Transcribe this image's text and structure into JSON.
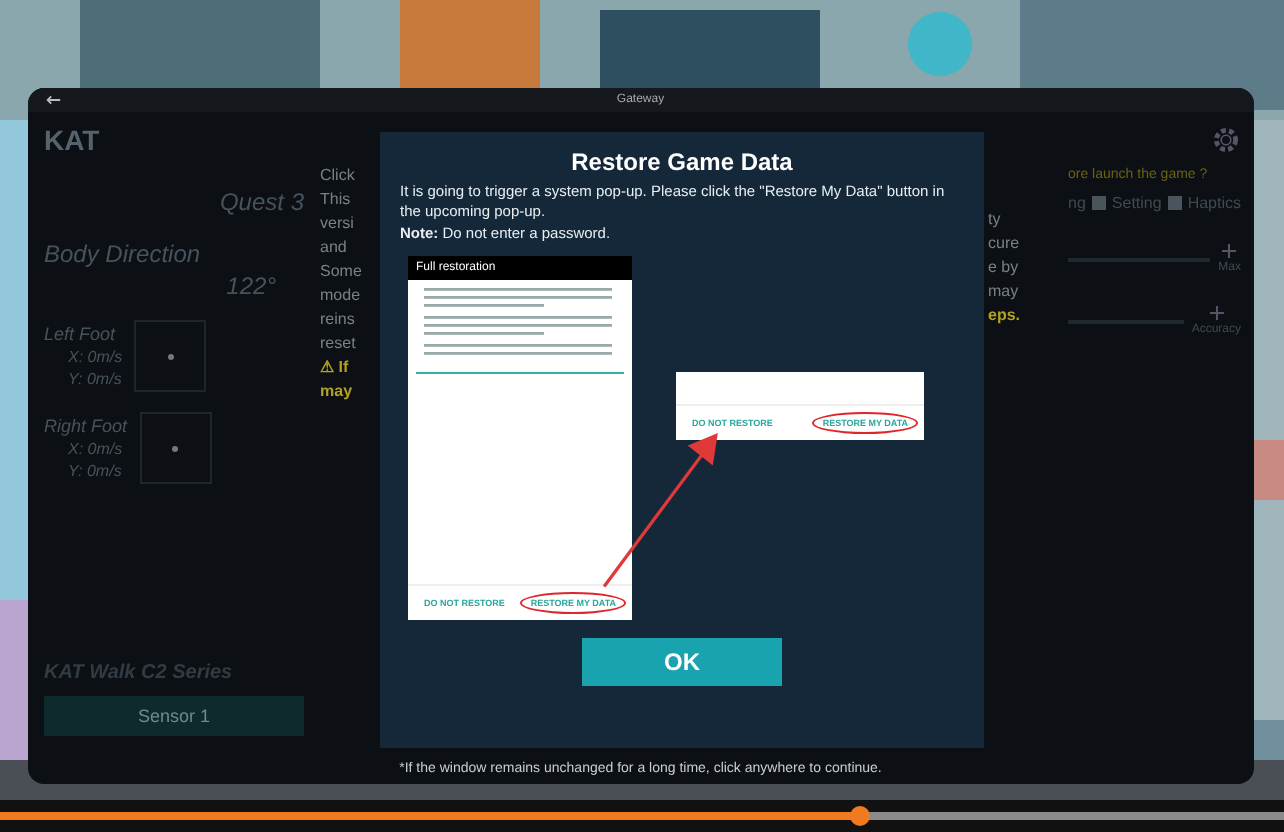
{
  "window": {
    "title": "Gateway"
  },
  "sidebar": {
    "logo": "KAT",
    "device": "Quest 3",
    "direction_label": "Body Direction",
    "direction_value": "122°",
    "feet": [
      {
        "label": "Left Foot",
        "x": "X: 0m/s",
        "y": "Y: 0m/s"
      },
      {
        "label": "Right Foot",
        "x": "X: 0m/s",
        "y": "Y: 0m/s"
      }
    ],
    "treadmill": "KAT Walk C2 Series",
    "sensor": "Sensor 1"
  },
  "left_fragments": [
    "Click",
    "This",
    "versi",
    "and",
    "Some",
    "mode",
    "reins",
    "reset"
  ],
  "left_warning": [
    "⚠ If",
    "may"
  ],
  "right_fragments": [
    "ty",
    "cure",
    "e by",
    "may"
  ],
  "right_warning": "eps.",
  "right_panel": {
    "prompt": "ore launch the game ?",
    "option_prefix": "ng",
    "options": [
      {
        "label": "Setting",
        "checked": true
      },
      {
        "label": "Haptics",
        "checked": true
      }
    ],
    "controls": [
      "Max",
      "Accuracy"
    ]
  },
  "dialog": {
    "title": "Restore Game Data",
    "message": "It is going to trigger a system pop-up. Please click the \"Restore My Data\" button in the upcoming pop-up.",
    "note": "**Note:** Do not enter a password.",
    "full_popup": {
      "title": "Full restoration",
      "buttons": [
        {
          "label": "DO NOT RESTORE",
          "highlighted": false
        },
        {
          "label": "RESTORE MY DATA",
          "highlighted": true
        }
      ]
    },
    "small_popup": {
      "buttons": [
        {
          "label": "DO NOT RESTORE",
          "highlighted": false
        },
        {
          "label": "RESTORE MY DATA",
          "highlighted": true
        }
      ]
    },
    "button": "OK"
  },
  "footnote": "*If the window remains unchanged for a long time, click anywhere to continue.",
  "video": {
    "progress": {
      "level": 0.67
    }
  }
}
